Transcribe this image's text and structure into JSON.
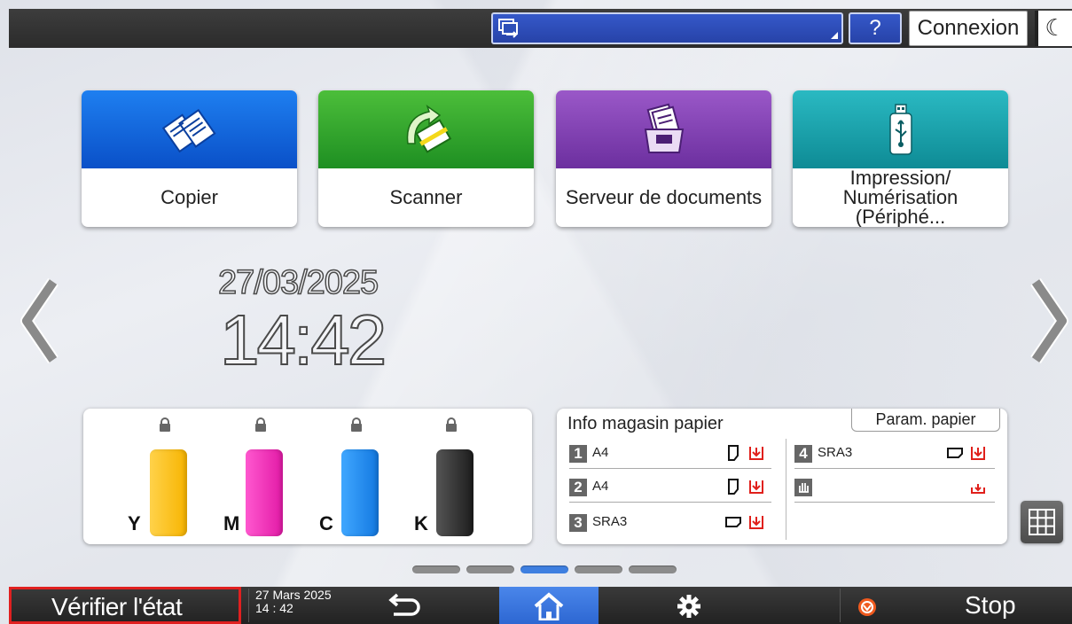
{
  "topbar": {
    "help_label": "?",
    "login_label": "Connexion",
    "sleep_label": "☾"
  },
  "apps": [
    {
      "label": "Copier"
    },
    {
      "label": "Scanner"
    },
    {
      "label": "Serveur de documents"
    },
    {
      "label": "Impression/ Numérisation (Périphé..."
    }
  ],
  "clock": {
    "date": "27/03/2025",
    "time": "14:42"
  },
  "toner": [
    {
      "letter": "Y",
      "color": "#f7b400"
    },
    {
      "letter": "M",
      "color": "#e21aa6"
    },
    {
      "letter": "C",
      "color": "#1378e0"
    },
    {
      "letter": "K",
      "color": "#1d1d1d"
    }
  ],
  "trays": {
    "title": "Info magasin papier",
    "param_button": "Param. papier",
    "items": [
      {
        "num": "1",
        "size": "A4"
      },
      {
        "num": "2",
        "size": "A4"
      },
      {
        "num": "3",
        "size": "SRA3"
      },
      {
        "num": "4",
        "size": "SRA3"
      }
    ]
  },
  "pages": {
    "count": 5,
    "active_index": 2
  },
  "bottombar": {
    "status_label": "Vérifier l'état",
    "date": "27 Mars 2025",
    "time": "14 : 42",
    "stop_label": "Stop"
  },
  "colors": {
    "home_active": "#2d67d2",
    "status_highlight": "#e02020"
  }
}
